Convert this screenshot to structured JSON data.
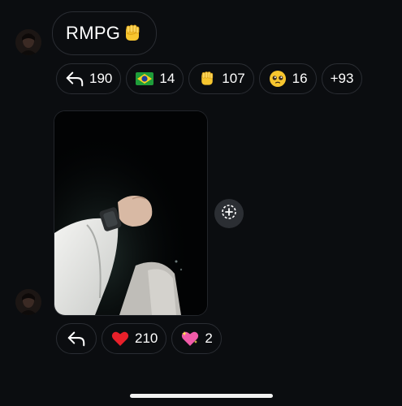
{
  "message1": {
    "text": "RMPG",
    "emoji": "raised-fist",
    "reactions": [
      {
        "icon": "reply-icon",
        "count": "190"
      },
      {
        "icon": "brazil-flag-icon",
        "count": "14"
      },
      {
        "icon": "fist-icon",
        "count": "107"
      },
      {
        "icon": "pleading-face-icon",
        "count": "16"
      },
      {
        "icon": "",
        "count": "+93"
      }
    ]
  },
  "message2": {
    "media": "photo",
    "reactions": [
      {
        "icon": "reply-icon",
        "count": ""
      },
      {
        "icon": "red-heart-icon",
        "count": "210"
      },
      {
        "icon": "sparkling-heart-icon",
        "count": "2"
      }
    ]
  },
  "colors": {
    "background": "#0b0d10",
    "pill_border": "#2a2d33",
    "text": "#ffffff",
    "save_button": "#2b2e33"
  }
}
